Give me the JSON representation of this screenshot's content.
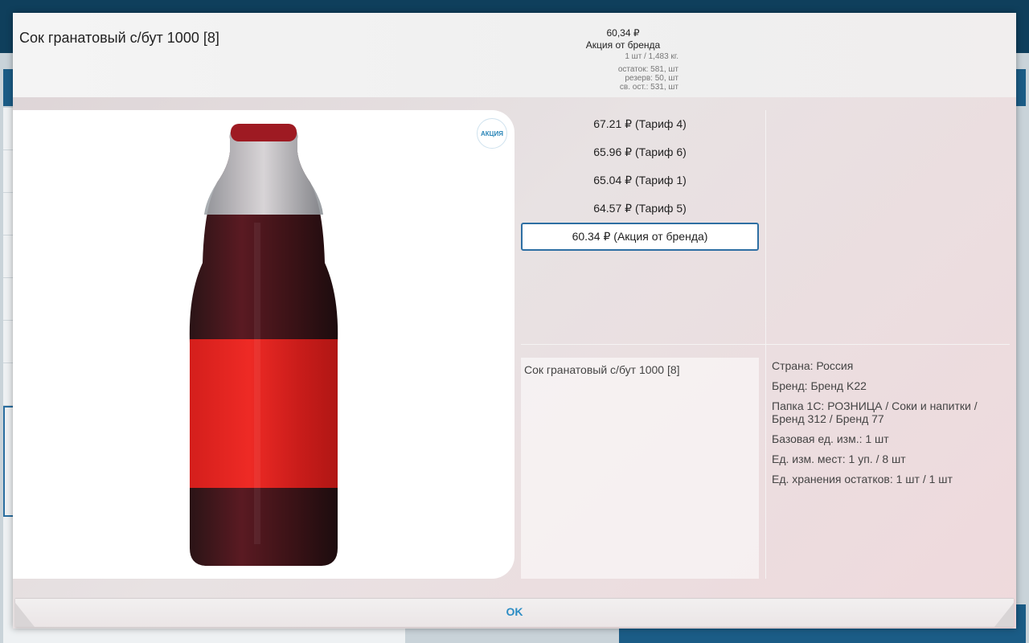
{
  "product": {
    "title": "Сок гранатовый с/бут 1000 [8]",
    "description": "Сок гранатовый с/бут 1000 [8]"
  },
  "price_summary": {
    "price": "60,34 ₽",
    "promo": "Акция от бренда",
    "unit": "1 шт / 1,483 кг.",
    "stock": "остаток: 581, шт",
    "reserve": "резерв: 50, шт",
    "free_stock": "св. ост.: 531, шт"
  },
  "badge": {
    "label": "АКЦИЯ"
  },
  "tariffs": [
    {
      "label": "67.21 ₽ (Тариф 4)"
    },
    {
      "label": "65.96 ₽ (Тариф 6)"
    },
    {
      "label": "65.04 ₽ (Тариф 1)"
    },
    {
      "label": "64.57 ₽ (Тариф 5)"
    },
    {
      "label": "60.34 ₽ (Акция от бренда)"
    }
  ],
  "properties": [
    {
      "text": "Страна: Россия"
    },
    {
      "text": "Бренд: Бренд K22"
    },
    {
      "text": "Папка 1С: РОЗНИЦА / Соки и напитки / Бренд 312 / Бренд 77"
    },
    {
      "text": "Базовая ед. изм.: 1 шт"
    },
    {
      "text": "Ед. изм. мест: 1 уп. / 8 шт"
    },
    {
      "text": "Ед. хранения остатков: 1 шт / 1 шт"
    }
  ],
  "footer": {
    "ok_label": "OK"
  },
  "colors": {
    "accent": "#2e6fa3",
    "ok_text": "#2d8dc4",
    "bottle_label": "#e52420"
  }
}
